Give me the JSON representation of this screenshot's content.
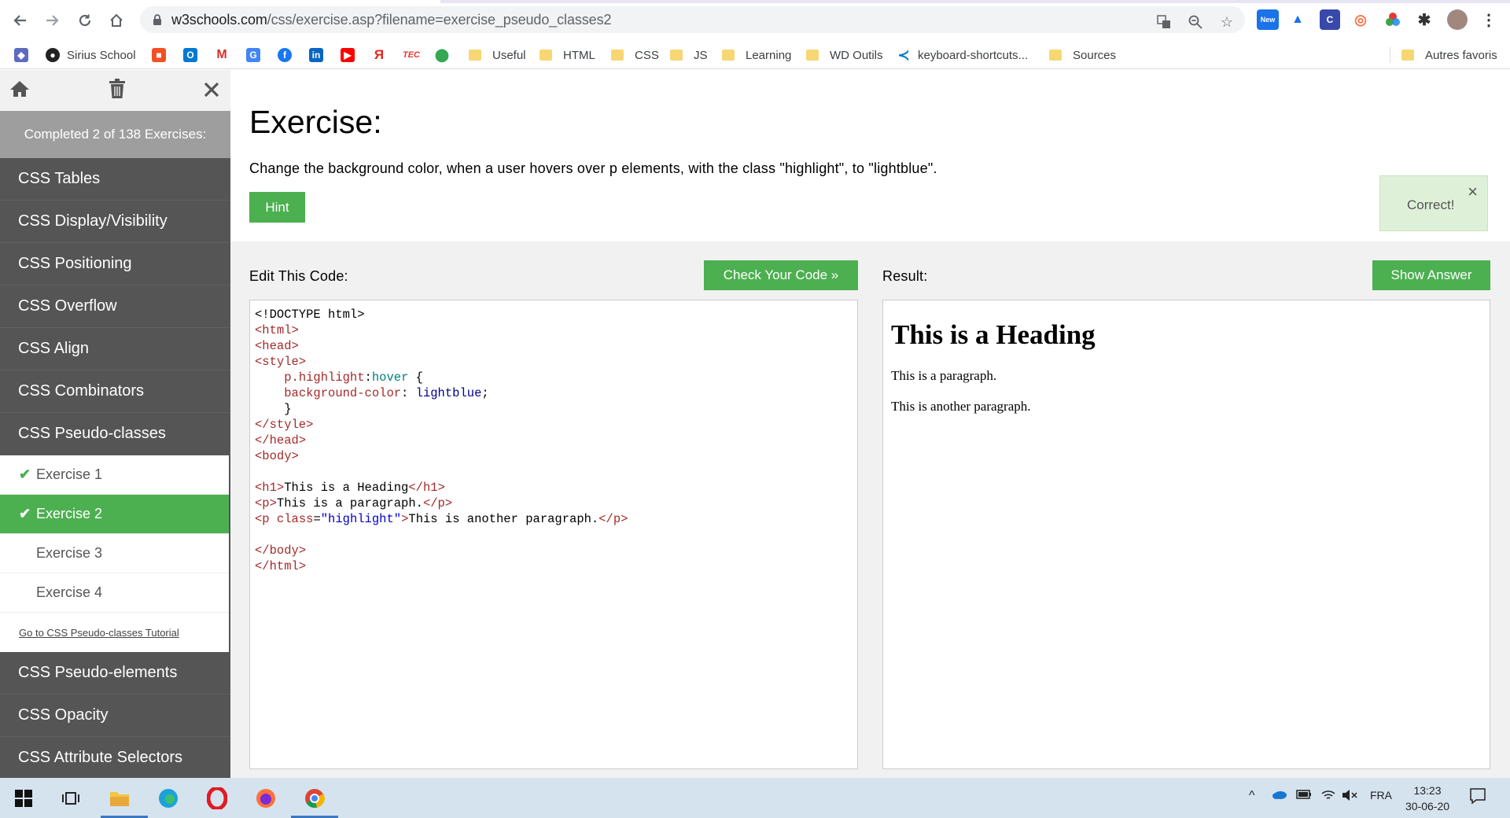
{
  "browser": {
    "url_host": "w3schools.com",
    "url_path": "/css/exercise.asp?filename=exercise_pseudo_classes2",
    "new_badge": "New",
    "bookmarks": [
      {
        "label": "Sirius School"
      },
      {
        "label": "Useful"
      },
      {
        "label": "HTML"
      },
      {
        "label": "CSS"
      },
      {
        "label": "JS"
      },
      {
        "label": "Learning"
      },
      {
        "label": "WD Outils"
      },
      {
        "label": "keyboard-shortcuts..."
      },
      {
        "label": "Sources"
      },
      {
        "label": "Autres favoris"
      }
    ],
    "bookmark_icon_text": {
      "yandex": "Я",
      "tec": "TEC"
    }
  },
  "sidebar": {
    "progress": "Completed 2 of 138 Exercises:",
    "items_top": [
      "CSS Tables",
      "CSS Display/Visibility",
      "CSS Positioning",
      "CSS Overflow",
      "CSS Align",
      "CSS Combinators",
      "CSS Pseudo-classes"
    ],
    "exercises": [
      {
        "label": "Exercise 1",
        "done": true
      },
      {
        "label": "Exercise 2",
        "done": true
      },
      {
        "label": "Exercise 3",
        "done": false
      },
      {
        "label": "Exercise 4",
        "done": false
      }
    ],
    "tutorial_link": "Go to CSS Pseudo-classes Tutorial",
    "items_bottom": [
      "CSS Pseudo-elements",
      "CSS Opacity",
      "CSS Attribute Selectors"
    ]
  },
  "exercise": {
    "title": "Exercise:",
    "instruction": "Change the background color, when a user hovers over p elements, with the class \"highlight\", to \"lightblue\".",
    "hint_label": "Hint",
    "correct_label": "Correct!",
    "edit_label": "Edit This Code:",
    "check_label": "Check Your Code »",
    "result_label": "Result:",
    "answer_label": "Show Answer"
  },
  "result": {
    "heading": "This is a Heading",
    "para1": "This is a paragraph.",
    "para2": "This is another paragraph."
  },
  "taskbar": {
    "lang": "FRA",
    "time": "13:23",
    "date": "30-06-20"
  },
  "colors": {
    "accent_green": "#4caf50",
    "sidebar_bg": "#555555",
    "correct_bg": "#dff0d8"
  }
}
